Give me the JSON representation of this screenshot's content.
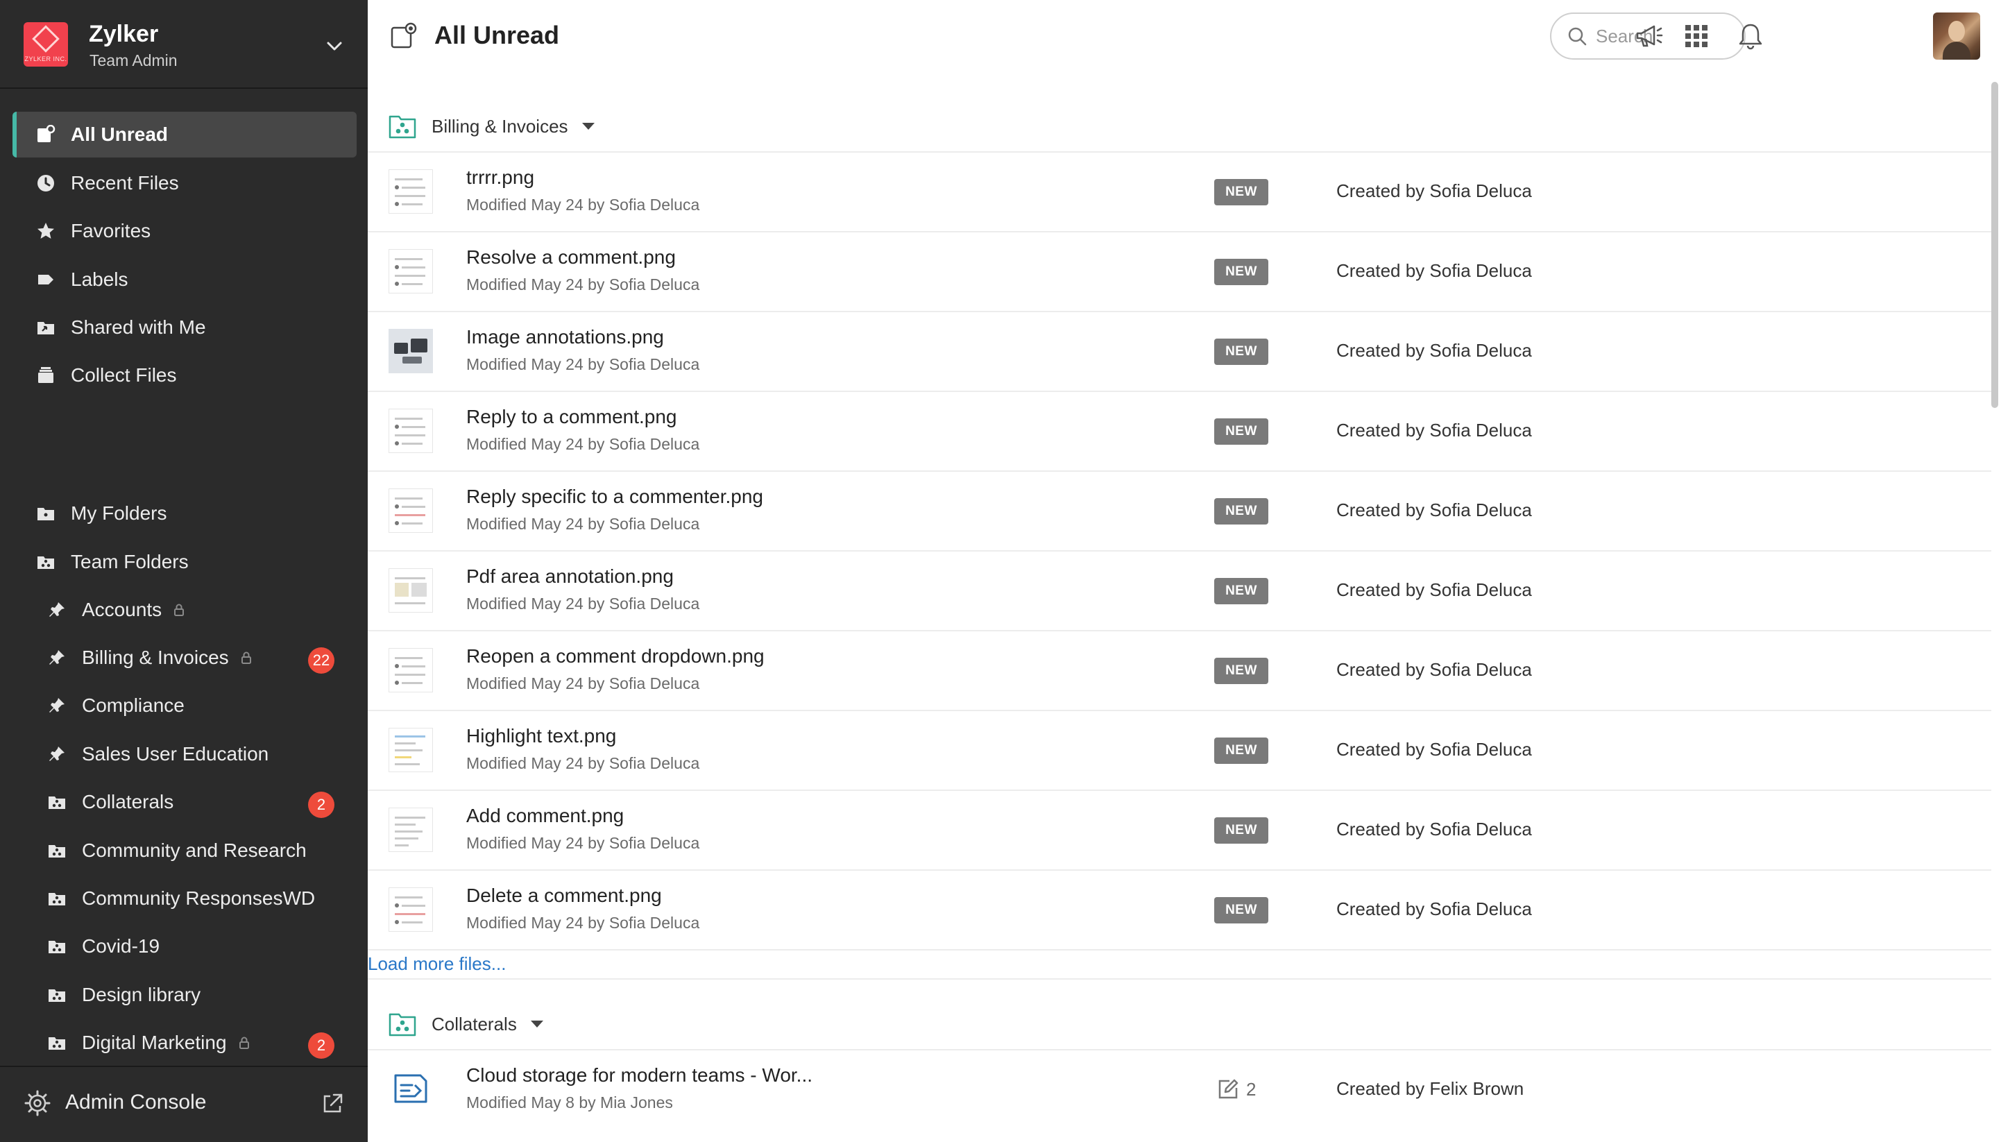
{
  "org": {
    "name": "Zylker",
    "role": "Team Admin",
    "logo_text": "ZYLKER INC."
  },
  "nav": {
    "primary": [
      {
        "label": "All Unread",
        "icon": "all-unread-icon",
        "active": true
      },
      {
        "label": "Recent Files",
        "icon": "clock-icon"
      },
      {
        "label": "Favorites",
        "icon": "star-icon"
      },
      {
        "label": "Labels",
        "icon": "label-icon"
      },
      {
        "label": "Shared with Me",
        "icon": "shared-folder-icon"
      },
      {
        "label": "Collect Files",
        "icon": "collect-files-icon"
      }
    ],
    "folders": [
      {
        "label": "My Folders",
        "icon": "folder-icon"
      },
      {
        "label": "Team Folders",
        "icon": "team-folder-icon"
      }
    ],
    "team_folders": [
      {
        "label": "Accounts",
        "icon": "pin-icon",
        "locked": true,
        "badge": ""
      },
      {
        "label": "Billing & Invoices",
        "icon": "pin-icon",
        "locked": true,
        "badge": "22"
      },
      {
        "label": "Compliance",
        "icon": "pin-icon",
        "locked": false,
        "badge": ""
      },
      {
        "label": "Sales User Education",
        "icon": "pin-icon",
        "locked": false,
        "badge": ""
      },
      {
        "label": "Collaterals",
        "icon": "team-folder-icon",
        "locked": false,
        "badge": "2"
      },
      {
        "label": "Community and Research",
        "icon": "team-folder-icon",
        "locked": false,
        "badge": ""
      },
      {
        "label": "Community ResponsesWD",
        "icon": "team-folder-icon",
        "locked": false,
        "badge": ""
      },
      {
        "label": "Covid-19",
        "icon": "team-folder-icon",
        "locked": false,
        "badge": ""
      },
      {
        "label": "Design library",
        "icon": "team-folder-icon",
        "locked": false,
        "badge": ""
      },
      {
        "label": "Digital Marketing",
        "icon": "team-folder-icon",
        "locked": true,
        "badge": "2"
      }
    ],
    "footer_label": "Admin Console"
  },
  "header": {
    "title": "All Unread",
    "search_placeholder": "Search"
  },
  "groups": [
    {
      "name": "Billing & Invoices",
      "files": [
        {
          "name": "trrrr.png",
          "meta": "Modified May 24 by Sofia Deluca",
          "tag": "NEW",
          "creator": "Created by Sofia Deluca",
          "thumb": "screenshot"
        },
        {
          "name": "Resolve a comment.png",
          "meta": "Modified May 24 by Sofia Deluca",
          "tag": "NEW",
          "creator": "Created by Sofia Deluca",
          "thumb": "screenshot"
        },
        {
          "name": "Image annotations.png",
          "meta": "Modified May 24 by Sofia Deluca",
          "tag": "NEW",
          "creator": "Created by Sofia Deluca",
          "thumb": "photo"
        },
        {
          "name": "Reply to a comment.png",
          "meta": "Modified May 24 by Sofia Deluca",
          "tag": "NEW",
          "creator": "Created by Sofia Deluca",
          "thumb": "screenshot"
        },
        {
          "name": "Reply specific to a commenter.png",
          "meta": "Modified May 24 by Sofia Deluca",
          "tag": "NEW",
          "creator": "Created by Sofia Deluca",
          "thumb": "screenshot"
        },
        {
          "name": "Pdf area annotation.png",
          "meta": "Modified May 24 by Sofia Deluca",
          "tag": "NEW",
          "creator": "Created by Sofia Deluca",
          "thumb": "screenshot"
        },
        {
          "name": "Reopen a comment dropdown.png",
          "meta": "Modified May 24 by Sofia Deluca",
          "tag": "NEW",
          "creator": "Created by Sofia Deluca",
          "thumb": "screenshot"
        },
        {
          "name": "Highlight text.png",
          "meta": "Modified May 24 by Sofia Deluca",
          "tag": "NEW",
          "creator": "Created by Sofia Deluca",
          "thumb": "screenshot"
        },
        {
          "name": "Add comment.png",
          "meta": "Modified May 24 by Sofia Deluca",
          "tag": "NEW",
          "creator": "Created by Sofia Deluca",
          "thumb": "screenshot"
        },
        {
          "name": "Delete a comment.png",
          "meta": "Modified May 24 by Sofia Deluca",
          "tag": "NEW",
          "creator": "Created by Sofia Deluca",
          "thumb": "screenshot"
        }
      ],
      "load_more": "Load more files..."
    },
    {
      "name": "Collaterals",
      "files": [
        {
          "name": "Cloud storage for modern teams - Wor...",
          "meta": "Modified May 8 by Mia Jones",
          "edits": "2",
          "creator": "Created by Felix Brown",
          "thumb": "doc"
        }
      ]
    }
  ],
  "colors": {
    "sidebar_bg": "#2b2b2b",
    "active_item_bg": "#474747",
    "active_accent": "#46b9a7",
    "badge": "#ee4b3b",
    "new_tag": "#7a7a7a",
    "link": "#2a78c8",
    "team_icon": "#2fa58e",
    "doc_icon": "#2a6fb0"
  }
}
